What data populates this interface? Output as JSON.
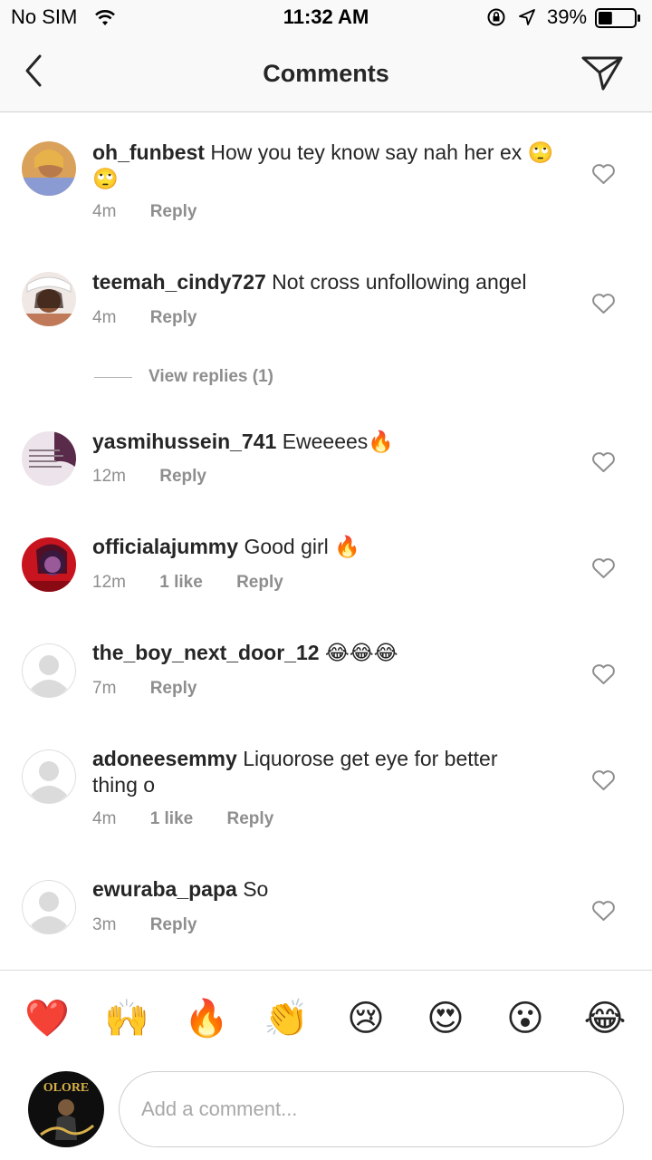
{
  "status_bar": {
    "carrier": "No SIM",
    "time": "11:32 AM",
    "battery": "39%",
    "battery_level": 0.39
  },
  "nav": {
    "title": "Comments"
  },
  "comments": [
    {
      "user": "oh_funbest",
      "text": "How you tey know say nah her ex 🙄🙄",
      "time": "4m",
      "likes": "",
      "reply": "Reply",
      "avatar": "photo"
    },
    {
      "user": "teemah_cindy727",
      "text": "Not cross unfollowing angel",
      "time": "4m",
      "likes": "",
      "reply": "Reply",
      "avatar": "photo"
    },
    {
      "user": "yasmihussein_741",
      "text": "Eweeees🔥",
      "time": "12m",
      "likes": "",
      "reply": "Reply",
      "avatar": "photo"
    },
    {
      "user": "officialajummy",
      "text": "Good girl  🔥",
      "time": "12m",
      "likes": "1 like",
      "reply": "Reply",
      "avatar": "photo"
    },
    {
      "user": "the_boy_next_door_12",
      "text": "😂😂😂",
      "time": "7m",
      "likes": "",
      "reply": "Reply",
      "avatar": "default"
    },
    {
      "user": "adoneesemmy",
      "text": "Liquorose get eye for better thing o",
      "time": "4m",
      "likes": "1 like",
      "reply": "Reply",
      "avatar": "default"
    },
    {
      "user": "ewuraba_papa",
      "text": "So",
      "time": "3m",
      "likes": "",
      "reply": "Reply",
      "avatar": "default"
    }
  ],
  "view_replies": "View replies (1)",
  "quick_emojis": [
    "❤️",
    "🙌",
    "🔥",
    "👏",
    "😢",
    "😍",
    "😮",
    "😂"
  ],
  "composer": {
    "placeholder": "Add a comment...",
    "avatar_text": "OLORE"
  },
  "colors": {
    "text": "#262626",
    "meta": "#8e8e8e",
    "bar_bg": "#f9f9f9"
  }
}
